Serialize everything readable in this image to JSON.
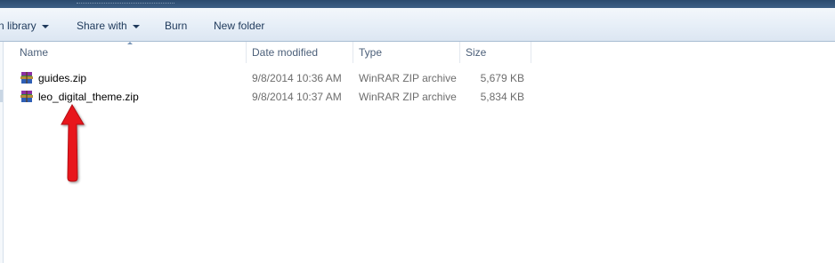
{
  "toolbar": {
    "library_label": "n library",
    "share_label": "Share with",
    "burn_label": "Burn",
    "new_folder_label": "New folder"
  },
  "columns": {
    "name": "Name",
    "date_modified": "Date modified",
    "type": "Type",
    "size": "Size"
  },
  "files": [
    {
      "name": "guides.zip",
      "date": "9/8/2014 10:36 AM",
      "type": "WinRAR ZIP archive",
      "size": "5,679 KB",
      "icon": "winrar-archive-icon"
    },
    {
      "name": "leo_digital_theme.zip",
      "date": "9/8/2014 10:37 AM",
      "type": "WinRAR ZIP archive",
      "size": "5,834 KB",
      "icon": "winrar-archive-icon"
    }
  ],
  "annotation": {
    "color": "#e8161b",
    "icon": "red-arrow-up-icon"
  }
}
